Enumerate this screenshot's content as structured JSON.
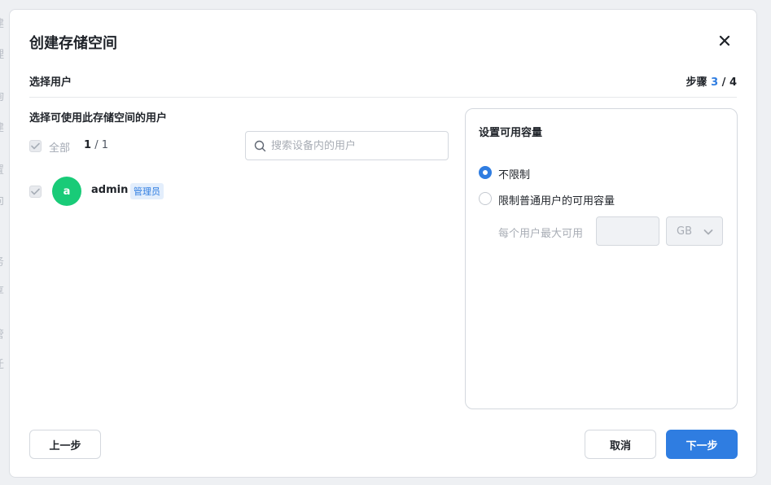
{
  "background": {
    "items": [
      "建",
      "理",
      "询",
      "建",
      "置",
      "向",
      "务",
      "享",
      "管",
      "迁"
    ]
  },
  "dialog": {
    "title": "创建存储空间",
    "step_name": "选择用户",
    "step_prefix": "步骤",
    "step_current": "3",
    "step_separator": "/",
    "step_total": "4"
  },
  "users_section": {
    "title": "选择可使用此存储空间的用户",
    "select_all_label": "全部",
    "selected_count": "1",
    "count_separator": "/",
    "total_count": "1",
    "search_placeholder": "搜索设备内的用户",
    "users": [
      {
        "avatar_letter": "a",
        "name": "admin",
        "badge": "管理员",
        "checked": true
      }
    ]
  },
  "capacity_panel": {
    "title": "设置可用容量",
    "option_unlimited": "不限制",
    "option_limited": "限制普通用户的可用容量",
    "selected_option": "unlimited",
    "max_per_user_label": "每个用户最大可用",
    "max_per_user_value": "",
    "unit": "GB"
  },
  "footer": {
    "prev_label": "上一步",
    "cancel_label": "取消",
    "next_label": "下一步"
  },
  "colors": {
    "primary": "#2f7de1",
    "avatar": "#19cb78",
    "badge_bg": "#e3eefc"
  },
  "icons": {
    "close": "close-icon",
    "search": "search-icon",
    "check": "check-icon",
    "dropdown": "chevron-down-icon"
  }
}
